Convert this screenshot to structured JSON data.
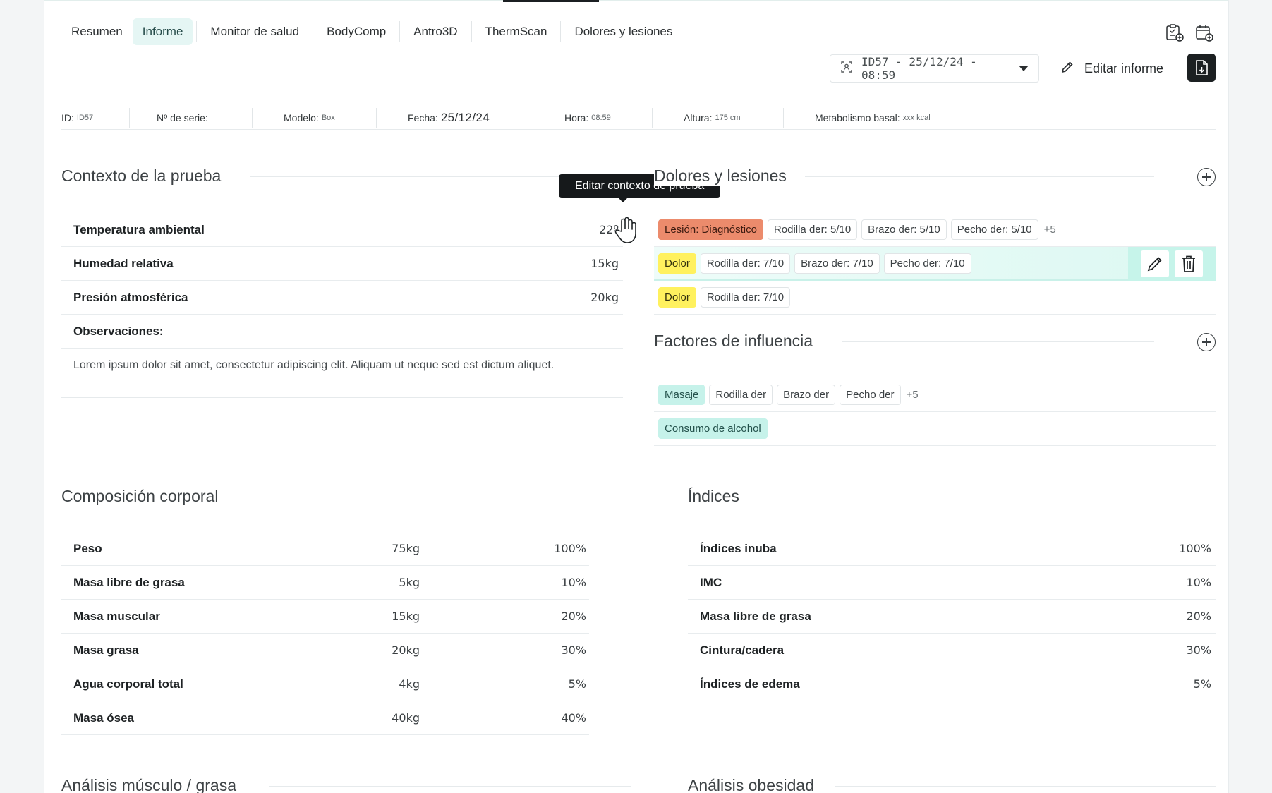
{
  "tabs": [
    {
      "label": "Resumen",
      "active": false
    },
    {
      "label": "Informe",
      "active": true
    },
    {
      "label": "Monitor de salud",
      "active": false
    },
    {
      "label": "BodyComp",
      "active": false
    },
    {
      "label": "Antro3D",
      "active": false
    },
    {
      "label": "ThermScan",
      "active": false
    },
    {
      "label": "Dolores y lesiones",
      "active": false
    }
  ],
  "toolbar": {
    "report_selector": "ID57 - 25/12/24 - 08:59",
    "edit_report_label": "Editar informe"
  },
  "meta": {
    "id_label": "ID:",
    "id_value": "ID57",
    "serial_label": "Nº de serie:",
    "model_label": "Modelo:",
    "model_value": "Box",
    "date_label": "Fecha:",
    "date_value": "25/12/24",
    "time_label": "Hora:",
    "time_value": "08:59",
    "height_label": "Altura:",
    "height_value": "175 cm",
    "bmr_label": "Metabolismo basal:",
    "bmr_value": "xxx kcal"
  },
  "context": {
    "title": "Contexto de la prueba",
    "tooltip": "Editar contexto de prueba",
    "rows": [
      {
        "label": "Temperatura ambiental",
        "value": "22º"
      },
      {
        "label": "Humedad relativa",
        "value": "15kg"
      },
      {
        "label": "Presión atmosférica",
        "value": "20kg"
      },
      {
        "label": "Observaciones:",
        "value": ""
      }
    ],
    "observations": "Lorem ipsum dolor sit amet, consectetur adipiscing elit. Aliquam ut neque sed est dictum aliquet."
  },
  "pains": {
    "title": "Dolores y lesiones",
    "rows": [
      {
        "tag": "Lesión: Diagnóstico",
        "tag_type": "injury",
        "chips": [
          "Rodilla der: 5/10",
          "Brazo der: 5/10",
          "Pecho der: 5/10"
        ],
        "more": "+5"
      },
      {
        "tag": "Dolor",
        "tag_type": "pain",
        "chips": [
          "Rodilla der: 7/10",
          "Brazo der: 7/10",
          "Pecho der: 7/10"
        ],
        "more": ""
      },
      {
        "tag": "Dolor",
        "tag_type": "pain",
        "chips": [
          "Rodilla der: 7/10"
        ],
        "more": ""
      }
    ]
  },
  "factors": {
    "title": "Factores de influencia",
    "row1": {
      "tag": "Masaje",
      "chips": [
        "Rodilla der",
        "Brazo der",
        "Pecho der"
      ],
      "more": "+5"
    },
    "row2": {
      "tag": "Consumo de alcohol"
    }
  },
  "composition": {
    "title": "Composición corporal",
    "rows": [
      {
        "label": "Peso",
        "value": "75kg",
        "pct": "100%"
      },
      {
        "label": "Masa libre de grasa",
        "value": "5kg",
        "pct": "10%"
      },
      {
        "label": "Masa muscular",
        "value": "15kg",
        "pct": "20%"
      },
      {
        "label": "Masa grasa",
        "value": "20kg",
        "pct": "30%"
      },
      {
        "label": "Agua corporal total",
        "value": "4kg",
        "pct": "5%"
      },
      {
        "label": "Masa ósea",
        "value": "40kg",
        "pct": "40%"
      }
    ]
  },
  "indices": {
    "title": "Índices",
    "rows": [
      {
        "label": "Índices inuba",
        "pct": "100%"
      },
      {
        "label": "IMC",
        "pct": "10%"
      },
      {
        "label": "Masa libre de grasa",
        "pct": "20%"
      },
      {
        "label": "Cintura/cadera",
        "pct": "30%"
      },
      {
        "label": "Índices de edema",
        "pct": "5%"
      }
    ]
  },
  "bottom": {
    "left_title": "Análisis músculo / grasa",
    "right_title": "Análisis obesidad"
  },
  "colors": {
    "accent_teal": "#c6f2ea",
    "injury": "#ec8b6c",
    "pain": "#fff15e",
    "tooltip_bg": "#16191b"
  }
}
